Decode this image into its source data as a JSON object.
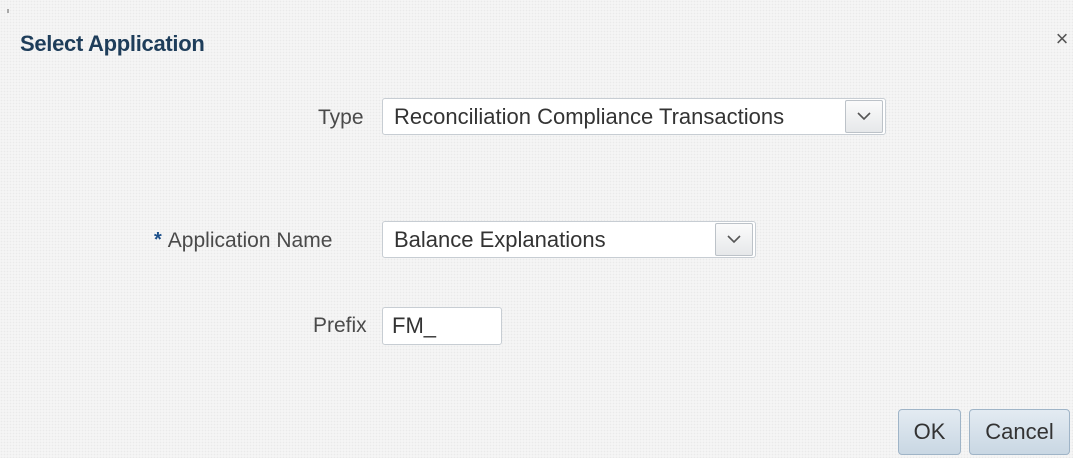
{
  "dialog": {
    "title": "Select Application",
    "close_glyph": "×"
  },
  "form": {
    "type": {
      "label": "Type",
      "value": "Reconciliation Compliance Transactions"
    },
    "application_name": {
      "required_marker": "*",
      "label": "Application Name",
      "value": "Balance Explanations"
    },
    "prefix": {
      "label": "Prefix",
      "value": "FM_"
    }
  },
  "buttons": {
    "ok": "OK",
    "cancel": "Cancel"
  },
  "icons": {
    "close": "close-icon",
    "dropdown": "chevron-down-icon"
  },
  "colors": {
    "title": "#1e3d5a",
    "required": "#1b4f8a",
    "button_bg": "#d6e1ea"
  }
}
